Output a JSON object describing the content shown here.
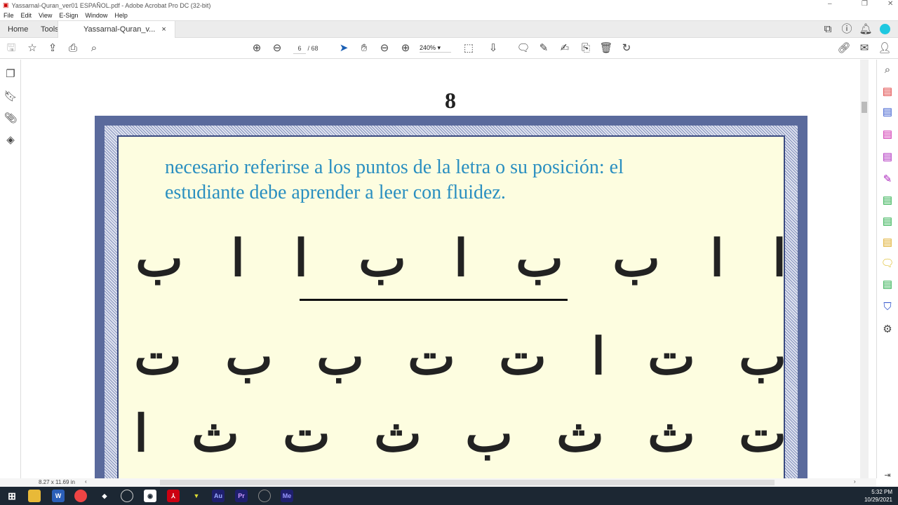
{
  "window": {
    "title": "Yassarnal-Quran_ver01 ESPAÑOL.pdf - Adobe Acrobat Pro DC (32-bit)"
  },
  "menu": [
    "File",
    "Edit",
    "View",
    "E-Sign",
    "Window",
    "Help"
  ],
  "tabs": {
    "home": "Home",
    "tools": "Tools",
    "doc": "Yassarnal-Quran_v...",
    "close": "×"
  },
  "toolbar": {
    "page_current": "6",
    "page_total": "/ 68",
    "zoom": "240%"
  },
  "document": {
    "page_number": "8",
    "paragraph_line1": "necesario referirse a los puntos de la letra o su posición: el",
    "paragraph_line2": "estudiante debe aprender a leer con fluidez.",
    "rows": [
      [
        "ب",
        "ا",
        "ا",
        "ب",
        "ا",
        "ب",
        "ب",
        "ا",
        "ا"
      ],
      [
        "ت",
        "ب",
        "ب",
        "ت",
        "ت",
        "ا",
        "ت",
        "ب"
      ],
      [
        "ا",
        "ث",
        "ت",
        "ث",
        "ب",
        "ث",
        "ث",
        "ت"
      ]
    ]
  },
  "status": {
    "page_size": "8.27 x 11.69 in"
  },
  "taskbar": {
    "time": "5:32 PM",
    "date": "10/29/2021",
    "apps": [
      "W",
      "Au",
      "Pr",
      "Me"
    ]
  },
  "colors": {
    "accent_text": "#2a8fc0",
    "page_bg": "#fdfde0",
    "border": "#5a6a9c"
  }
}
